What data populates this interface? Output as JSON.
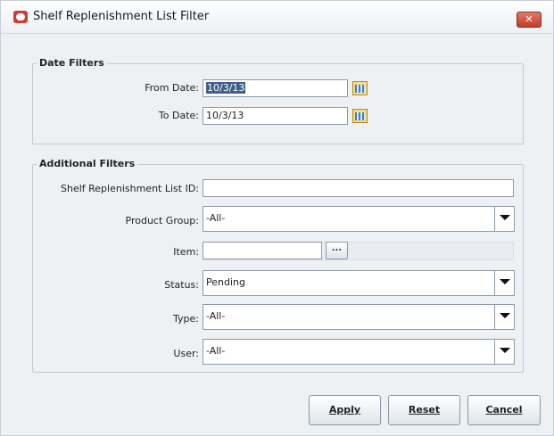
{
  "window": {
    "title": "Shelf Replenishment List Filter",
    "close_glyph": "✕",
    "logo_icon": "oracle-logo-icon"
  },
  "date_filters": {
    "title": "Date Filters",
    "from_label": "From Date:",
    "from_value": "10/3/13",
    "to_label": "To Date:",
    "to_value": "10/3/13",
    "calendar_icon": "calendar-icon"
  },
  "additional_filters": {
    "title": "Additional Filters",
    "list_id_label": "Shelf Replenishment List ID:",
    "list_id_value": "",
    "product_group_label": "Product Group:",
    "product_group_value": "-All-",
    "item_label": "Item:",
    "item_value": "",
    "item_lookup_label": "...",
    "status_label": "Status:",
    "status_value": "Pending",
    "type_label": "Type:",
    "type_value": "-All-",
    "user_label": "User:",
    "user_value": "-All-"
  },
  "buttons": {
    "apply": "Apply",
    "reset": "Reset",
    "cancel": "Cancel"
  },
  "colors": {
    "close_button": "#c9402f",
    "logo": "#d43a2f",
    "selection": "#3f5f8a"
  }
}
